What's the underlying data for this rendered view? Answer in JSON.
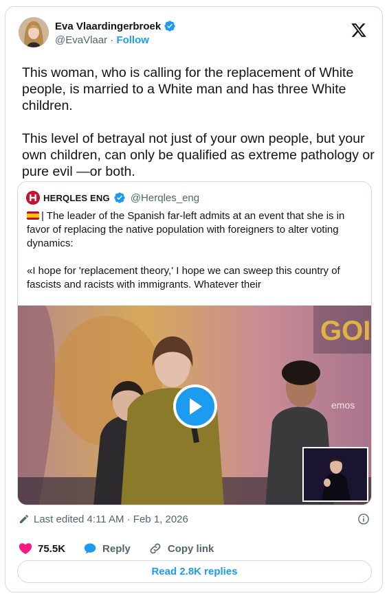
{
  "author": {
    "name": "Eva Vlaardingerbroek",
    "handle": "@EvaVlaar",
    "separator": "·",
    "follow_label": "Follow"
  },
  "tweet": {
    "text": "This woman, who is calling for the replacement of White people, is married to a White man and has three White children.\n\nThis level of betrayal not just of your own people, but your own children, can only be qualified as extreme pathology or pure evil —or both."
  },
  "quoted": {
    "name": "HERQLES ENG",
    "handle": "@Herqles_eng",
    "text": "| The leader of the Spanish far-left admits at an event that she is in favor of replacing the native population with foreigners to alter voting dynamics:\n\n«I hope for 'replacement theory,' I hope we can sweep this country of fascists and racists with immigrants. Whatever their",
    "video_bg_text_1": "GOI",
    "video_bg_text_2": "emos"
  },
  "meta": {
    "edited": "Last edited 4:11 AM · Feb 1, 2026"
  },
  "actions": {
    "likes": "75.5K",
    "reply_label": "Reply",
    "copy_link_label": "Copy link",
    "read_replies_label": "Read 2.8K replies"
  },
  "colors": {
    "accent": "#1d9bf0",
    "like": "#f91880",
    "text": "#0f1419",
    "muted": "#536471",
    "border": "#cfd9de"
  },
  "icons": [
    "verified-badge-icon",
    "x-logo-icon",
    "pencil-icon",
    "info-icon",
    "heart-icon",
    "reply-bubble-icon",
    "link-icon",
    "play-icon",
    "spain-flag-icon"
  ]
}
